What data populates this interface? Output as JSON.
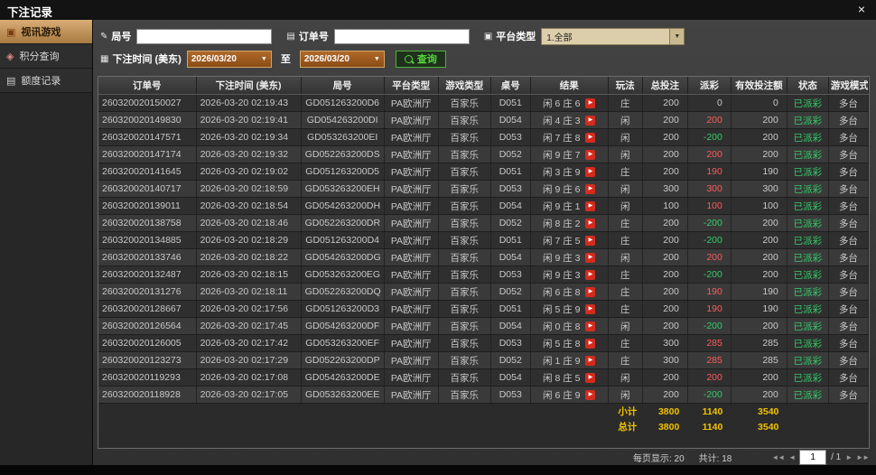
{
  "window": {
    "title": "下注记录",
    "close_label": "×"
  },
  "sidebar": {
    "items": [
      {
        "label": "视讯游戏",
        "active": true
      },
      {
        "label": "积分查询",
        "active": false
      },
      {
        "label": "额度记录",
        "active": false
      }
    ]
  },
  "filters": {
    "round_label": "局号",
    "order_label": "订单号",
    "platform_label": "平台类型",
    "platform_value": "1.全部",
    "time_label": "下注时间 (美东)",
    "date_from": "2026/03/20",
    "to_label": "至",
    "date_to": "2026/03/20",
    "search_label": "查询"
  },
  "table": {
    "headers": [
      "订单号",
      "下注时间 (美东)",
      "局号",
      "平台类型",
      "游戏类型",
      "桌号",
      "结果",
      "玩法",
      "总投注",
      "派彩",
      "有效投注额",
      "状态",
      "游戏模式"
    ],
    "rows": [
      {
        "order": "260320020150027",
        "time": "2026-03-20 02:19:43",
        "round": "GD051263200D6",
        "platform": "PA欧洲厅",
        "game": "百家乐",
        "table_no": "D051",
        "result": "闲 6 庄 6",
        "play": "庄",
        "bet": "200",
        "payout": "0",
        "valid": "0",
        "status": "已派彩",
        "mode": "多台"
      },
      {
        "order": "260320020149830",
        "time": "2026-03-20 02:19:41",
        "round": "GD054263200DI",
        "platform": "PA欧洲厅",
        "game": "百家乐",
        "table_no": "D054",
        "result": "闲 4 庄 3",
        "play": "闲",
        "bet": "200",
        "payout": "200",
        "valid": "200",
        "status": "已派彩",
        "mode": "多台"
      },
      {
        "order": "260320020147571",
        "time": "2026-03-20 02:19:34",
        "round": "GD053263200EI",
        "platform": "PA欧洲厅",
        "game": "百家乐",
        "table_no": "D053",
        "result": "闲 7 庄 8",
        "play": "闲",
        "bet": "200",
        "payout": "-200",
        "valid": "200",
        "status": "已派彩",
        "mode": "多台"
      },
      {
        "order": "260320020147174",
        "time": "2026-03-20 02:19:32",
        "round": "GD052263200DS",
        "platform": "PA欧洲厅",
        "game": "百家乐",
        "table_no": "D052",
        "result": "闲 9 庄 7",
        "play": "闲",
        "bet": "200",
        "payout": "200",
        "valid": "200",
        "status": "已派彩",
        "mode": "多台"
      },
      {
        "order": "260320020141645",
        "time": "2026-03-20 02:19:02",
        "round": "GD051263200D5",
        "platform": "PA欧洲厅",
        "game": "百家乐",
        "table_no": "D051",
        "result": "闲 3 庄 9",
        "play": "庄",
        "bet": "200",
        "payout": "190",
        "valid": "190",
        "status": "已派彩",
        "mode": "多台"
      },
      {
        "order": "260320020140717",
        "time": "2026-03-20 02:18:59",
        "round": "GD053263200EH",
        "platform": "PA欧洲厅",
        "game": "百家乐",
        "table_no": "D053",
        "result": "闲 9 庄 6",
        "play": "闲",
        "bet": "300",
        "payout": "300",
        "valid": "300",
        "status": "已派彩",
        "mode": "多台"
      },
      {
        "order": "260320020139011",
        "time": "2026-03-20 02:18:54",
        "round": "GD054263200DH",
        "platform": "PA欧洲厅",
        "game": "百家乐",
        "table_no": "D054",
        "result": "闲 9 庄 1",
        "play": "闲",
        "bet": "100",
        "payout": "100",
        "valid": "100",
        "status": "已派彩",
        "mode": "多台"
      },
      {
        "order": "260320020138758",
        "time": "2026-03-20 02:18:46",
        "round": "GD052263200DR",
        "platform": "PA欧洲厅",
        "game": "百家乐",
        "table_no": "D052",
        "result": "闲 8 庄 2",
        "play": "庄",
        "bet": "200",
        "payout": "-200",
        "valid": "200",
        "status": "已派彩",
        "mode": "多台"
      },
      {
        "order": "260320020134885",
        "time": "2026-03-20 02:18:29",
        "round": "GD051263200D4",
        "platform": "PA欧洲厅",
        "game": "百家乐",
        "table_no": "D051",
        "result": "闲 7 庄 5",
        "play": "庄",
        "bet": "200",
        "payout": "-200",
        "valid": "200",
        "status": "已派彩",
        "mode": "多台"
      },
      {
        "order": "260320020133746",
        "time": "2026-03-20 02:18:22",
        "round": "GD054263200DG",
        "platform": "PA欧洲厅",
        "game": "百家乐",
        "table_no": "D054",
        "result": "闲 9 庄 3",
        "play": "闲",
        "bet": "200",
        "payout": "200",
        "valid": "200",
        "status": "已派彩",
        "mode": "多台"
      },
      {
        "order": "260320020132487",
        "time": "2026-03-20 02:18:15",
        "round": "GD053263200EG",
        "platform": "PA欧洲厅",
        "game": "百家乐",
        "table_no": "D053",
        "result": "闲 9 庄 3",
        "play": "庄",
        "bet": "200",
        "payout": "-200",
        "valid": "200",
        "status": "已派彩",
        "mode": "多台"
      },
      {
        "order": "260320020131276",
        "time": "2026-03-20 02:18:11",
        "round": "GD052263200DQ",
        "platform": "PA欧洲厅",
        "game": "百家乐",
        "table_no": "D052",
        "result": "闲 6 庄 8",
        "play": "庄",
        "bet": "200",
        "payout": "190",
        "valid": "190",
        "status": "已派彩",
        "mode": "多台"
      },
      {
        "order": "260320020128667",
        "time": "2026-03-20 02:17:56",
        "round": "GD051263200D3",
        "platform": "PA欧洲厅",
        "game": "百家乐",
        "table_no": "D051",
        "result": "闲 5 庄 9",
        "play": "庄",
        "bet": "200",
        "payout": "190",
        "valid": "190",
        "status": "已派彩",
        "mode": "多台"
      },
      {
        "order": "260320020126564",
        "time": "2026-03-20 02:17:45",
        "round": "GD054263200DF",
        "platform": "PA欧洲厅",
        "game": "百家乐",
        "table_no": "D054",
        "result": "闲 0 庄 8",
        "play": "闲",
        "bet": "200",
        "payout": "-200",
        "valid": "200",
        "status": "已派彩",
        "mode": "多台"
      },
      {
        "order": "260320020126005",
        "time": "2026-03-20 02:17:42",
        "round": "GD053263200EF",
        "platform": "PA欧洲厅",
        "game": "百家乐",
        "table_no": "D053",
        "result": "闲 5 庄 8",
        "play": "庄",
        "bet": "300",
        "payout": "285",
        "valid": "285",
        "status": "已派彩",
        "mode": "多台"
      },
      {
        "order": "260320020123273",
        "time": "2026-03-20 02:17:29",
        "round": "GD052263200DP",
        "platform": "PA欧洲厅",
        "game": "百家乐",
        "table_no": "D052",
        "result": "闲 1 庄 9",
        "play": "庄",
        "bet": "300",
        "payout": "285",
        "valid": "285",
        "status": "已派彩",
        "mode": "多台"
      },
      {
        "order": "260320020119293",
        "time": "2026-03-20 02:17:08",
        "round": "GD054263200DE",
        "platform": "PA欧洲厅",
        "game": "百家乐",
        "table_no": "D054",
        "result": "闲 8 庄 5",
        "play": "闲",
        "bet": "200",
        "payout": "200",
        "valid": "200",
        "status": "已派彩",
        "mode": "多台"
      },
      {
        "order": "260320020118928",
        "time": "2026-03-20 02:17:05",
        "round": "GD053263200EE",
        "platform": "PA欧洲厅",
        "game": "百家乐",
        "table_no": "D053",
        "result": "闲 6 庄 9",
        "play": "闲",
        "bet": "200",
        "payout": "-200",
        "valid": "200",
        "status": "已派彩",
        "mode": "多台"
      }
    ],
    "subtotal": {
      "label": "小计",
      "total_bet": "3800",
      "payout": "1140",
      "valid_bet": "3540"
    },
    "grand_total": {
      "label": "总计",
      "total_bet": "3800",
      "payout": "1140",
      "valid_bet": "3540"
    }
  },
  "footer": {
    "page_size_label": "每页显示: 20",
    "total_label": "共计: 18",
    "page_value": "1",
    "page_total": "/ 1"
  },
  "icons": {
    "close": "×",
    "monitor": "▣",
    "gem": "◈",
    "document": "▤",
    "round_field": "✎",
    "order_field": "▤",
    "platform_field": "▣",
    "calendar": "▦",
    "chevron_down": "▼",
    "replay": "▶",
    "first_page": "◄◄",
    "prev_page": "◄",
    "next_page": "►",
    "last_page": "►►"
  },
  "colors": {
    "payout_positive": "#ff5a5a",
    "payout_negative": "#35cc6a",
    "status_paid": "#35cc6a",
    "totals_text": "#f2c200",
    "active_tab": "#c89a62"
  }
}
